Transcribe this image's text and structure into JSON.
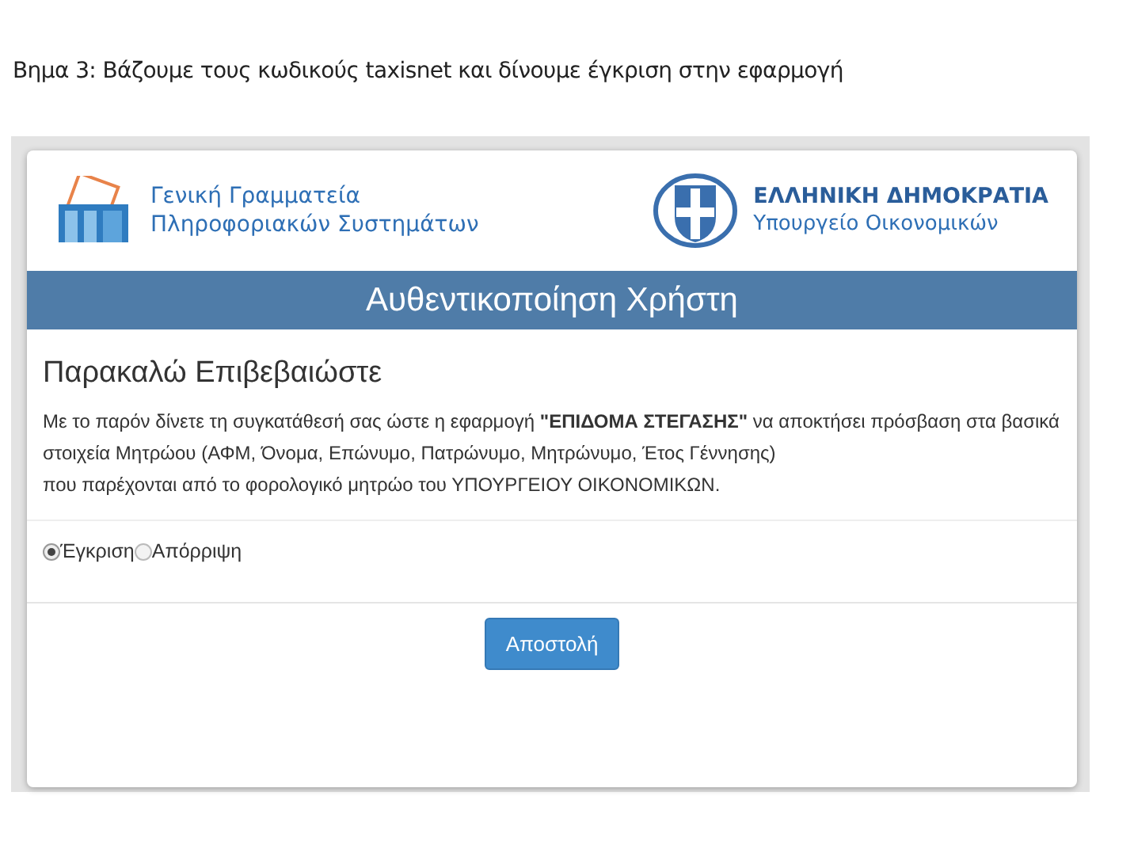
{
  "caption": "Βημα 3: Βάζουμε τους κωδικούς taxisnet και δίνουμε έγκριση στην εφαρμογή",
  "header": {
    "left_org": [
      "Γενική Γραμματεία",
      "Πληροφοριακών Συστημάτων"
    ],
    "right_org": {
      "title": "ΕΛΛΗΝΙΚΗ ΔΗΜΟΚΡΑΤΙΑ",
      "subtitle": "Υπουργείο Οικονομικών"
    }
  },
  "banner": "Αυθεντικοποίηση Χρήστη",
  "heading": "Παρακαλώ Επιβεβαιώστε",
  "paragraphs": [
    "Με το παρόν δίνετε τη συγκατάθεσή σας ώστε η εφαρμογή **\"ΕΠΙΔΟΜΑ ΣΤΕΓΑΣΗΣ\"** να αποκτήσει πρόσβαση στα βασικά στοιχεία Μητρώου (ΑΦΜ, Όνομα, Επώνυμο, Πατρώνυμο, Μητρώνυμο, Έτος Γέννησης)",
    "που παρέχονται από το φορολογικό μητρώο του ΥΠΟΥΡΓΕΙΟΥ ΟΙΚΟΝΟΜΙΚΩΝ."
  ],
  "options": [
    {
      "label": "Έγκριση",
      "selected": true
    },
    {
      "label": "Απόρριψη",
      "selected": false
    }
  ],
  "submit_button": "Αποστολή"
}
